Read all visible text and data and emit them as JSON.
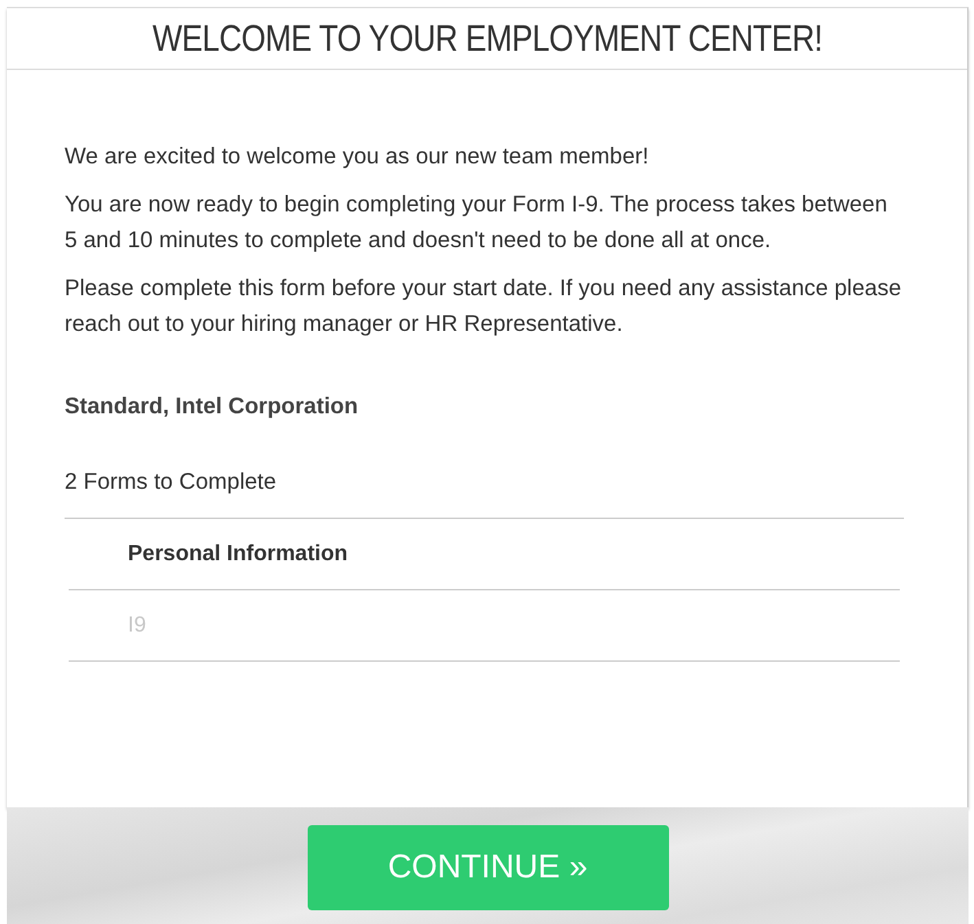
{
  "title": "WELCOME TO YOUR EMPLOYMENT CENTER!",
  "paragraphs": [
    "We are excited to welcome you as our new team member!",
    "You are now ready to begin completing your Form I-9. The process takes between 5 and 10 minutes to complete and doesn't need to be done all at once.",
    "Please complete this form before your start date. If you need any assistance please reach out to your hiring manager or HR Representative."
  ],
  "company": "Standard, Intel Corporation",
  "forms_count": "2 Forms to Complete",
  "forms": [
    {
      "label": "Personal Information",
      "disabled": false
    },
    {
      "label": "I9",
      "disabled": true
    }
  ],
  "continue_button": "CONTINUE »"
}
